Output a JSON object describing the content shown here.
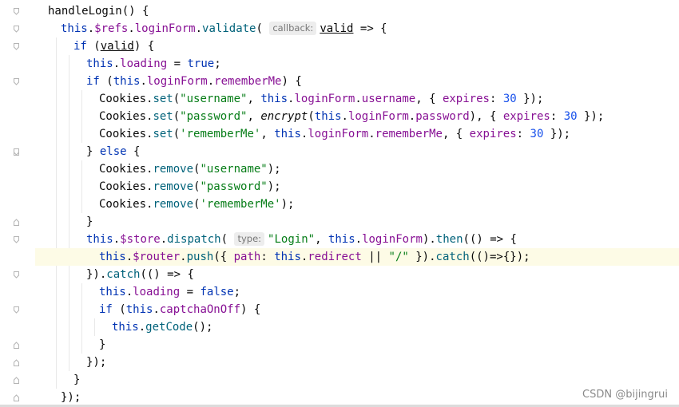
{
  "editor": {
    "language": "javascript",
    "current_line_index": 14,
    "lines": [
      {
        "indent": 0,
        "tokens": [
          {
            "t": "plain",
            "v": "handleLogin() {"
          }
        ]
      },
      {
        "indent": 1,
        "tokens": [
          {
            "t": "this",
            "v": "this"
          },
          {
            "t": "plain",
            "v": "."
          },
          {
            "t": "prop",
            "v": "$refs"
          },
          {
            "t": "plain",
            "v": "."
          },
          {
            "t": "prop",
            "v": "loginForm"
          },
          {
            "t": "plain",
            "v": "."
          },
          {
            "t": "fn",
            "v": "validate"
          },
          {
            "t": "plain",
            "v": "( "
          },
          {
            "t": "hint",
            "v": "callback:"
          },
          {
            "t": "local",
            "v": "valid"
          },
          {
            "t": "plain",
            "v": " => {"
          }
        ]
      },
      {
        "indent": 2,
        "tokens": [
          {
            "t": "kw",
            "v": "if"
          },
          {
            "t": "plain",
            "v": " ("
          },
          {
            "t": "local",
            "v": "valid"
          },
          {
            "t": "plain",
            "v": ") {"
          }
        ]
      },
      {
        "indent": 3,
        "tokens": [
          {
            "t": "this",
            "v": "this"
          },
          {
            "t": "plain",
            "v": "."
          },
          {
            "t": "prop",
            "v": "loading"
          },
          {
            "t": "plain",
            "v": " = "
          },
          {
            "t": "kw",
            "v": "true"
          },
          {
            "t": "plain",
            "v": ";"
          }
        ]
      },
      {
        "indent": 3,
        "tokens": [
          {
            "t": "kw",
            "v": "if"
          },
          {
            "t": "plain",
            "v": " ("
          },
          {
            "t": "this",
            "v": "this"
          },
          {
            "t": "plain",
            "v": "."
          },
          {
            "t": "prop",
            "v": "loginForm"
          },
          {
            "t": "plain",
            "v": "."
          },
          {
            "t": "prop",
            "v": "rememberMe"
          },
          {
            "t": "plain",
            "v": ") {"
          }
        ]
      },
      {
        "indent": 4,
        "tokens": [
          {
            "t": "plain",
            "v": "Cookies."
          },
          {
            "t": "fn",
            "v": "set"
          },
          {
            "t": "plain",
            "v": "("
          },
          {
            "t": "str",
            "v": "\"username\""
          },
          {
            "t": "plain",
            "v": ", "
          },
          {
            "t": "this",
            "v": "this"
          },
          {
            "t": "plain",
            "v": "."
          },
          {
            "t": "prop",
            "v": "loginForm"
          },
          {
            "t": "plain",
            "v": "."
          },
          {
            "t": "prop",
            "v": "username"
          },
          {
            "t": "plain",
            "v": ", { "
          },
          {
            "t": "prop",
            "v": "expires"
          },
          {
            "t": "plain",
            "v": ": "
          },
          {
            "t": "num",
            "v": "30"
          },
          {
            "t": "plain",
            "v": " });"
          }
        ]
      },
      {
        "indent": 4,
        "tokens": [
          {
            "t": "plain",
            "v": "Cookies."
          },
          {
            "t": "fn",
            "v": "set"
          },
          {
            "t": "plain",
            "v": "("
          },
          {
            "t": "str",
            "v": "\"password\""
          },
          {
            "t": "plain",
            "v": ", "
          },
          {
            "t": "italic",
            "v": "encrypt"
          },
          {
            "t": "plain",
            "v": "("
          },
          {
            "t": "this",
            "v": "this"
          },
          {
            "t": "plain",
            "v": "."
          },
          {
            "t": "prop",
            "v": "loginForm"
          },
          {
            "t": "plain",
            "v": "."
          },
          {
            "t": "prop",
            "v": "password"
          },
          {
            "t": "plain",
            "v": "), { "
          },
          {
            "t": "prop",
            "v": "expires"
          },
          {
            "t": "plain",
            "v": ": "
          },
          {
            "t": "num",
            "v": "30"
          },
          {
            "t": "plain",
            "v": " });"
          }
        ]
      },
      {
        "indent": 4,
        "tokens": [
          {
            "t": "plain",
            "v": "Cookies."
          },
          {
            "t": "fn",
            "v": "set"
          },
          {
            "t": "plain",
            "v": "("
          },
          {
            "t": "str",
            "v": "'rememberMe'"
          },
          {
            "t": "plain",
            "v": ", "
          },
          {
            "t": "this",
            "v": "this"
          },
          {
            "t": "plain",
            "v": "."
          },
          {
            "t": "prop",
            "v": "loginForm"
          },
          {
            "t": "plain",
            "v": "."
          },
          {
            "t": "prop",
            "v": "rememberMe"
          },
          {
            "t": "plain",
            "v": ", { "
          },
          {
            "t": "prop",
            "v": "expires"
          },
          {
            "t": "plain",
            "v": ": "
          },
          {
            "t": "num",
            "v": "30"
          },
          {
            "t": "plain",
            "v": " });"
          }
        ]
      },
      {
        "indent": 3,
        "tokens": [
          {
            "t": "plain",
            "v": "} "
          },
          {
            "t": "kw",
            "v": "else"
          },
          {
            "t": "plain",
            "v": " {"
          }
        ]
      },
      {
        "indent": 4,
        "tokens": [
          {
            "t": "plain",
            "v": "Cookies."
          },
          {
            "t": "fn",
            "v": "remove"
          },
          {
            "t": "plain",
            "v": "("
          },
          {
            "t": "str",
            "v": "\"username\""
          },
          {
            "t": "plain",
            "v": ");"
          }
        ]
      },
      {
        "indent": 4,
        "tokens": [
          {
            "t": "plain",
            "v": "Cookies."
          },
          {
            "t": "fn",
            "v": "remove"
          },
          {
            "t": "plain",
            "v": "("
          },
          {
            "t": "str",
            "v": "\"password\""
          },
          {
            "t": "plain",
            "v": ");"
          }
        ]
      },
      {
        "indent": 4,
        "tokens": [
          {
            "t": "plain",
            "v": "Cookies."
          },
          {
            "t": "fn",
            "v": "remove"
          },
          {
            "t": "plain",
            "v": "("
          },
          {
            "t": "str",
            "v": "'rememberMe'"
          },
          {
            "t": "plain",
            "v": ");"
          }
        ]
      },
      {
        "indent": 3,
        "tokens": [
          {
            "t": "plain",
            "v": "}"
          }
        ]
      },
      {
        "indent": 3,
        "tokens": [
          {
            "t": "this",
            "v": "this"
          },
          {
            "t": "plain",
            "v": "."
          },
          {
            "t": "prop",
            "v": "$store"
          },
          {
            "t": "plain",
            "v": "."
          },
          {
            "t": "fn",
            "v": "dispatch"
          },
          {
            "t": "plain",
            "v": "( "
          },
          {
            "t": "hint",
            "v": "type:"
          },
          {
            "t": "str",
            "v": "\"Login\""
          },
          {
            "t": "plain",
            "v": ", "
          },
          {
            "t": "this",
            "v": "this"
          },
          {
            "t": "plain",
            "v": "."
          },
          {
            "t": "prop",
            "v": "loginForm"
          },
          {
            "t": "plain",
            "v": ")."
          },
          {
            "t": "fn",
            "v": "then"
          },
          {
            "t": "plain",
            "v": "(() => {"
          }
        ]
      },
      {
        "indent": 4,
        "tokens": [
          {
            "t": "this",
            "v": "this"
          },
          {
            "t": "plain",
            "v": "."
          },
          {
            "t": "prop",
            "v": "$router"
          },
          {
            "t": "plain",
            "v": "."
          },
          {
            "t": "fn",
            "v": "push"
          },
          {
            "t": "plain",
            "v": "({ "
          },
          {
            "t": "prop",
            "v": "path"
          },
          {
            "t": "plain",
            "v": ": "
          },
          {
            "t": "this",
            "v": "this"
          },
          {
            "t": "plain",
            "v": "."
          },
          {
            "t": "prop",
            "v": "redirect"
          },
          {
            "t": "plain",
            "v": " || "
          },
          {
            "t": "str",
            "v": "\"/\""
          },
          {
            "t": "plain",
            "v": " })."
          },
          {
            "t": "fn",
            "v": "catch"
          },
          {
            "t": "plain",
            "v": "(()=>{});"
          }
        ]
      },
      {
        "indent": 3,
        "tokens": [
          {
            "t": "plain",
            "v": "})."
          },
          {
            "t": "fn",
            "v": "catch"
          },
          {
            "t": "plain",
            "v": "(() => {"
          }
        ]
      },
      {
        "indent": 4,
        "tokens": [
          {
            "t": "this",
            "v": "this"
          },
          {
            "t": "plain",
            "v": "."
          },
          {
            "t": "prop",
            "v": "loading"
          },
          {
            "t": "plain",
            "v": " = "
          },
          {
            "t": "kw",
            "v": "false"
          },
          {
            "t": "plain",
            "v": ";"
          }
        ]
      },
      {
        "indent": 4,
        "tokens": [
          {
            "t": "kw",
            "v": "if"
          },
          {
            "t": "plain",
            "v": " ("
          },
          {
            "t": "this",
            "v": "this"
          },
          {
            "t": "plain",
            "v": "."
          },
          {
            "t": "prop",
            "v": "captchaOnOff"
          },
          {
            "t": "plain",
            "v": ") {"
          }
        ]
      },
      {
        "indent": 5,
        "tokens": [
          {
            "t": "this",
            "v": "this"
          },
          {
            "t": "plain",
            "v": "."
          },
          {
            "t": "fn",
            "v": "getCode"
          },
          {
            "t": "plain",
            "v": "();"
          }
        ]
      },
      {
        "indent": 4,
        "tokens": [
          {
            "t": "plain",
            "v": "}"
          }
        ]
      },
      {
        "indent": 3,
        "tokens": [
          {
            "t": "plain",
            "v": "});"
          }
        ]
      },
      {
        "indent": 2,
        "tokens": [
          {
            "t": "plain",
            "v": "}"
          }
        ]
      },
      {
        "indent": 1,
        "tokens": [
          {
            "t": "plain",
            "v": "});"
          }
        ]
      }
    ]
  },
  "gutter": {
    "folds": [
      {
        "line": 0,
        "kind": "open"
      },
      {
        "line": 1,
        "kind": "open"
      },
      {
        "line": 2,
        "kind": "open"
      },
      {
        "line": 4,
        "kind": "open"
      },
      {
        "line": 8,
        "kind": "close"
      },
      {
        "line": 8,
        "kind": "open"
      },
      {
        "line": 12,
        "kind": "close"
      },
      {
        "line": 13,
        "kind": "open"
      },
      {
        "line": 15,
        "kind": "open"
      },
      {
        "line": 17,
        "kind": "open"
      },
      {
        "line": 19,
        "kind": "close"
      },
      {
        "line": 20,
        "kind": "close"
      },
      {
        "line": 21,
        "kind": "close"
      },
      {
        "line": 22,
        "kind": "close"
      }
    ]
  },
  "watermark": "CSDN @bijingrui"
}
